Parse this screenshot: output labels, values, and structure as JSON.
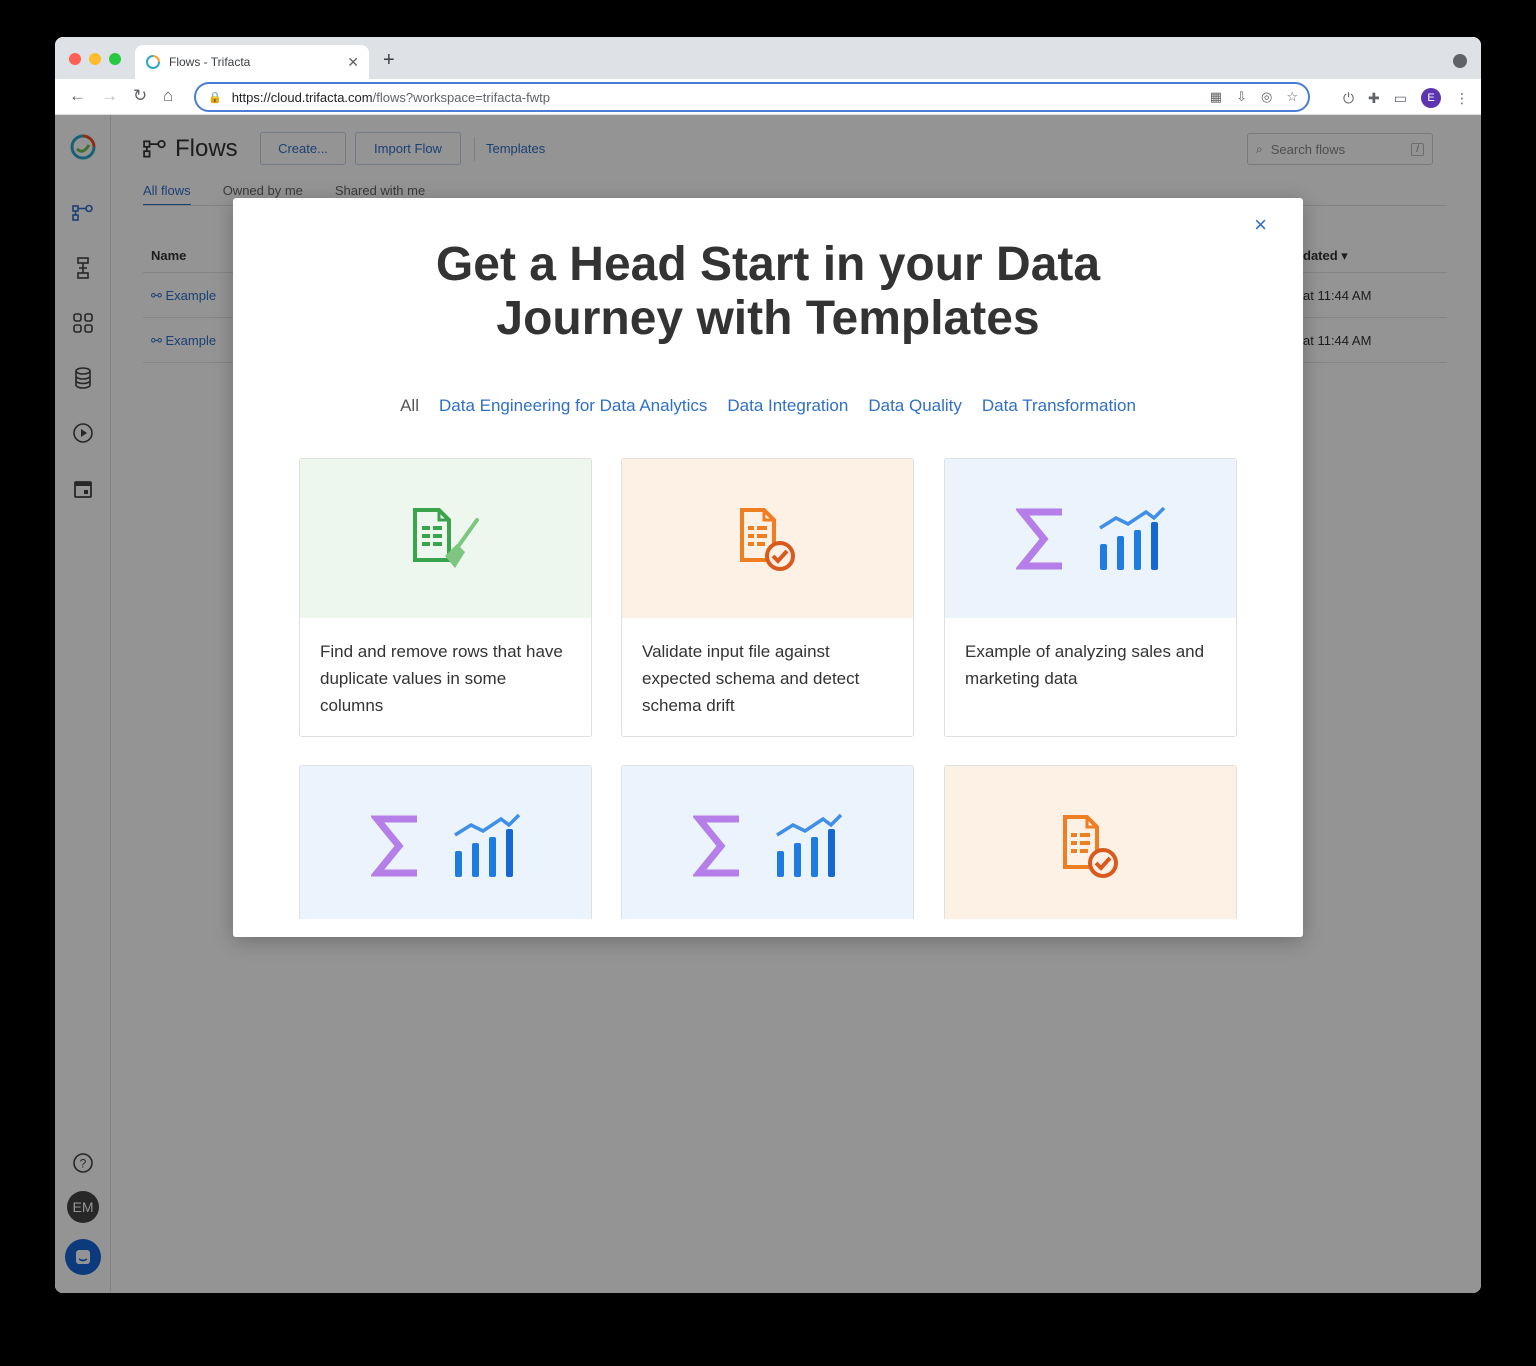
{
  "browser": {
    "tab_title": "Flows - Trifacta",
    "tab_close": "✕",
    "new_tab": "+",
    "url_host": "https://cloud.trifacta.com",
    "url_path": "/flows?workspace=trifacta-fwtp",
    "profile_initial": "E"
  },
  "app": {
    "page_title": "Flows",
    "create_label": "Create...",
    "import_label": "Import Flow",
    "templates_label": "Templates",
    "search_placeholder": "Search flows",
    "search_shortcut": "/",
    "subtabs": [
      "All flows",
      "Owned by me",
      "Shared with me"
    ],
    "table": {
      "col_name": "Name",
      "col_updated": "dated",
      "rows": [
        {
          "name": "Example",
          "time": "at 11:44 AM"
        },
        {
          "name": "Example",
          "time": "at 11:44 AM"
        }
      ]
    },
    "user_initials": "EM"
  },
  "modal": {
    "close": "×",
    "title_line1": "Get a Head Start in your Data",
    "title_line2": "Journey with Templates",
    "filters": [
      "All",
      "Data Engineering for Data Analytics",
      "Data Integration",
      "Data Quality",
      "Data Transformation"
    ],
    "cards": [
      {
        "icon": "document-broom-icon",
        "theme": "green",
        "desc": "Find and remove rows that have duplicate values in some columns"
      },
      {
        "icon": "document-check-icon",
        "theme": "orange",
        "desc": "Validate input file against expected schema and detect schema drift"
      },
      {
        "icon": "sigma-chart-icon",
        "theme": "blue",
        "desc": "Example of analyzing sales and marketing data"
      },
      {
        "icon": "sigma-chart-icon",
        "theme": "blue",
        "desc": ""
      },
      {
        "icon": "sigma-chart-icon",
        "theme": "blue",
        "desc": ""
      },
      {
        "icon": "document-check-icon",
        "theme": "orange",
        "desc": ""
      }
    ]
  },
  "colors": {
    "accent": "#2f6fc9",
    "green": "#3aa34b",
    "orange": "#ef7d22",
    "purple": "#b57ee8",
    "blue": "#1e7be0"
  }
}
